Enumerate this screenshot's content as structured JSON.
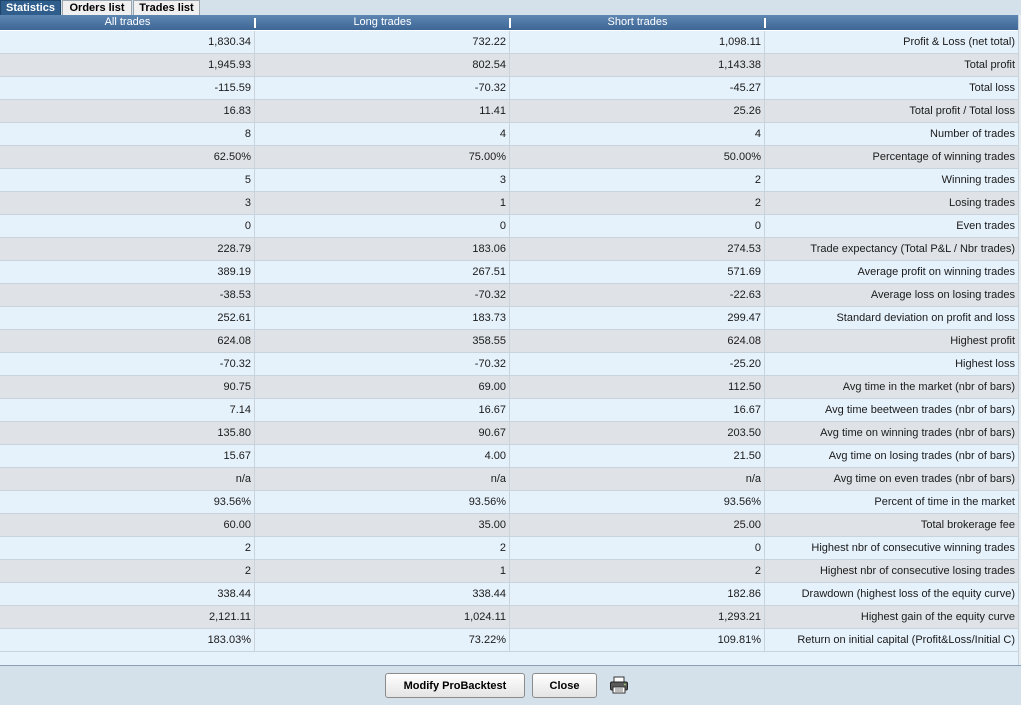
{
  "tabs": [
    {
      "label": "Statistics",
      "active": true
    },
    {
      "label": "Orders list",
      "active": false
    },
    {
      "label": "Trades list",
      "active": false
    }
  ],
  "columns": [
    "All trades",
    "Long trades",
    "Short trades"
  ],
  "rows": [
    {
      "label": "Profit & Loss (net total)",
      "all": "1,830.34",
      "long": "732.22",
      "short": "1,098.11"
    },
    {
      "label": "Total profit",
      "all": "1,945.93",
      "long": "802.54",
      "short": "1,143.38"
    },
    {
      "label": "Total loss",
      "all": "-115.59",
      "long": "-70.32",
      "short": "-45.27"
    },
    {
      "label": "Total profit / Total loss",
      "all": "16.83",
      "long": "11.41",
      "short": "25.26"
    },
    {
      "label": "Number of trades",
      "all": "8",
      "long": "4",
      "short": "4"
    },
    {
      "label": "Percentage of winning trades",
      "all": "62.50%",
      "long": "75.00%",
      "short": "50.00%"
    },
    {
      "label": "Winning trades",
      "all": "5",
      "long": "3",
      "short": "2"
    },
    {
      "label": "Losing trades",
      "all": "3",
      "long": "1",
      "short": "2"
    },
    {
      "label": "Even trades",
      "all": "0",
      "long": "0",
      "short": "0"
    },
    {
      "label": "Trade expectancy (Total P&L / Nbr trades)",
      "all": "228.79",
      "long": "183.06",
      "short": "274.53"
    },
    {
      "label": "Average profit on winning trades",
      "all": "389.19",
      "long": "267.51",
      "short": "571.69"
    },
    {
      "label": "Average loss on losing trades",
      "all": "-38.53",
      "long": "-70.32",
      "short": "-22.63"
    },
    {
      "label": "Standard deviation on profit and loss",
      "all": "252.61",
      "long": "183.73",
      "short": "299.47"
    },
    {
      "label": "Highest profit",
      "all": "624.08",
      "long": "358.55",
      "short": "624.08"
    },
    {
      "label": "Highest loss",
      "all": "-70.32",
      "long": "-70.32",
      "short": "-25.20"
    },
    {
      "label": "Avg time in the market (nbr of bars)",
      "all": "90.75",
      "long": "69.00",
      "short": "112.50"
    },
    {
      "label": "Avg time beetween trades (nbr of bars)",
      "all": "7.14",
      "long": "16.67",
      "short": "16.67"
    },
    {
      "label": "Avg time on winning trades (nbr of bars)",
      "all": "135.80",
      "long": "90.67",
      "short": "203.50"
    },
    {
      "label": "Avg time on losing trades (nbr of bars)",
      "all": "15.67",
      "long": "4.00",
      "short": "21.50"
    },
    {
      "label": "Avg time on even trades (nbr of bars)",
      "all": "n/a",
      "long": "n/a",
      "short": "n/a"
    },
    {
      "label": "Percent of time in the market",
      "all": "93.56%",
      "long": "93.56%",
      "short": "93.56%"
    },
    {
      "label": "Total brokerage fee",
      "all": "60.00",
      "long": "35.00",
      "short": "25.00"
    },
    {
      "label": "Highest nbr of consecutive winning trades",
      "all": "2",
      "long": "2",
      "short": "0"
    },
    {
      "label": "Highest nbr of consecutive losing trades",
      "all": "2",
      "long": "1",
      "short": "2"
    },
    {
      "label": "Drawdown (highest loss of the equity curve)",
      "all": "338.44",
      "long": "338.44",
      "short": "182.86"
    },
    {
      "label": "Highest gain of the equity curve",
      "all": "2,121.11",
      "long": "1,024.11",
      "short": "1,293.21"
    },
    {
      "label": "Return on initial capital (Profit&Loss/Initial C)",
      "all": "183.03%",
      "long": "73.22%",
      "short": "109.81%"
    }
  ],
  "buttons": {
    "modify": "Modify ProBacktest",
    "close": "Close"
  },
  "icons": {
    "print": "printer-icon"
  },
  "colors": {
    "active_tab": "#2f5d8c",
    "header": "#4a75a5",
    "row_odd": "#e6f2fb",
    "row_even": "#dfe3e7"
  }
}
